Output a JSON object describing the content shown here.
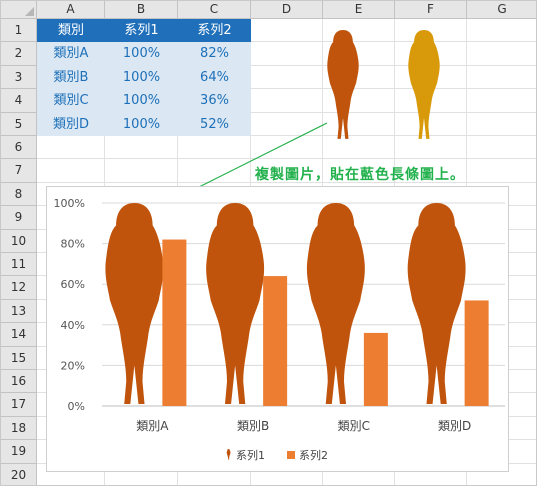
{
  "columns": [
    "A",
    "B",
    "C",
    "D",
    "E",
    "F",
    "G"
  ],
  "rows": [
    "1",
    "2",
    "3",
    "4",
    "5",
    "6",
    "7",
    "8",
    "9",
    "10",
    "11",
    "12",
    "13",
    "14",
    "15",
    "16",
    "17",
    "18",
    "19",
    "20"
  ],
  "table": {
    "headers": [
      "類別",
      "系列1",
      "系列2"
    ],
    "rows": [
      [
        "類別A",
        "100%",
        "82%"
      ],
      [
        "類別B",
        "100%",
        "64%"
      ],
      [
        "類別C",
        "100%",
        "36%"
      ],
      [
        "類別D",
        "100%",
        "52%"
      ]
    ]
  },
  "annotation": "複製圖片，貼在藍色長條圖上。",
  "colors": {
    "header_fill": "#1f6fba",
    "body_fill": "#dbe8f4",
    "body_text": "#1d6fb8",
    "figure_dark": "#c0540c",
    "figure_gold": "#d89a0a",
    "series2": "#ed7d31",
    "annotation": "#22b14c"
  },
  "icons": [
    "woman-silhouette-icon"
  ],
  "chart_data": {
    "type": "bar",
    "categories": [
      "類別A",
      "類別B",
      "類別C",
      "類別D"
    ],
    "series": [
      {
        "name": "系列1",
        "values": [
          1.0,
          1.0,
          1.0,
          1.0
        ],
        "marker": "woman-silhouette-icon"
      },
      {
        "name": "系列2",
        "values": [
          0.82,
          0.64,
          0.36,
          0.52
        ]
      }
    ],
    "ylim": [
      0,
      1
    ],
    "yticks": [
      "0%",
      "20%",
      "40%",
      "60%",
      "80%",
      "100%"
    ],
    "grid": true,
    "legend": "bottom"
  }
}
